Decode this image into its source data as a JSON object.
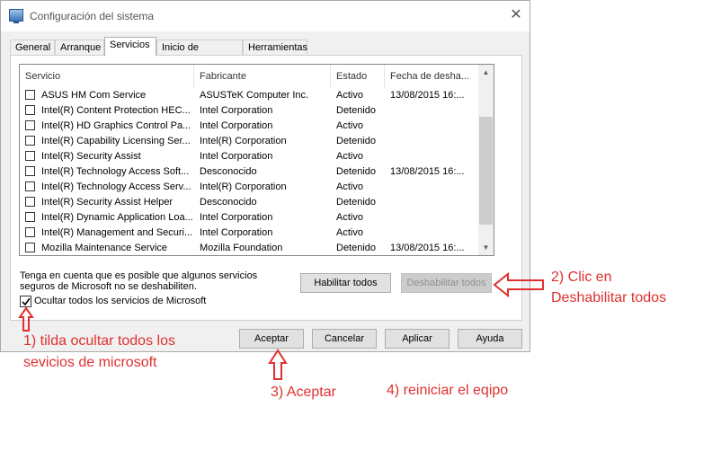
{
  "window": {
    "title": "Configuración del sistema",
    "close_glyph": "✕"
  },
  "tabs": [
    {
      "label": "General"
    },
    {
      "label": "Arranque"
    },
    {
      "label": "Servicios",
      "active": true
    },
    {
      "label": "Inicio de Windows"
    },
    {
      "label": "Herramientas"
    }
  ],
  "table": {
    "headers": [
      "Servicio",
      "Fabricante",
      "Estado",
      "Fecha de desha..."
    ],
    "rows": [
      {
        "servicio": "ASUS HM Com Service",
        "fabricante": "ASUSTeK Computer Inc.",
        "estado": "Activo",
        "fecha": "13/08/2015 16:..."
      },
      {
        "servicio": "Intel(R) Content Protection HEC...",
        "fabricante": "Intel Corporation",
        "estado": "Detenido",
        "fecha": ""
      },
      {
        "servicio": "Intel(R) HD Graphics Control Pa...",
        "fabricante": "Intel Corporation",
        "estado": "Activo",
        "fecha": ""
      },
      {
        "servicio": "Intel(R) Capability Licensing Ser...",
        "fabricante": "Intel(R) Corporation",
        "estado": "Detenido",
        "fecha": ""
      },
      {
        "servicio": "Intel(R) Security Assist",
        "fabricante": "Intel Corporation",
        "estado": "Activo",
        "fecha": ""
      },
      {
        "servicio": "Intel(R) Technology Access Soft...",
        "fabricante": "Desconocido",
        "estado": "Detenido",
        "fecha": "13/08/2015 16:..."
      },
      {
        "servicio": "Intel(R) Technology Access Serv...",
        "fabricante": "Intel(R) Corporation",
        "estado": "Activo",
        "fecha": ""
      },
      {
        "servicio": "Intel(R) Security Assist Helper",
        "fabricante": "Desconocido",
        "estado": "Detenido",
        "fecha": ""
      },
      {
        "servicio": "Intel(R) Dynamic Application Loa...",
        "fabricante": "Intel Corporation",
        "estado": "Activo",
        "fecha": ""
      },
      {
        "servicio": "Intel(R) Management and Securi...",
        "fabricante": "Intel Corporation",
        "estado": "Activo",
        "fecha": ""
      },
      {
        "servicio": "Mozilla Maintenance Service",
        "fabricante": "Mozilla Foundation",
        "estado": "Detenido",
        "fecha": "13/08/2015 16:..."
      }
    ]
  },
  "note": "Tenga en cuenta que es posible que algunos servicios seguros de Microsoft no se deshabiliten.",
  "buttons": {
    "enable_all": "Habilitar todos",
    "disable_all": "Deshabilitar todos",
    "ok": "Aceptar",
    "cancel": "Cancelar",
    "apply": "Aplicar",
    "help": "Ayuda"
  },
  "hide_ms_checkbox": {
    "label": "Ocultar todos los servicios de Microsoft",
    "checked": true
  },
  "annotations": {
    "step1_line1": "1) tilda ocultar todos los",
    "step1_line2": "sevicios de microsoft",
    "step2_line1": "2) Clic en",
    "step2_line2": "Deshabilitar todos",
    "step3": "3) Aceptar",
    "step4": "4) reiniciar el eqipo",
    "arrow_color": "#e03030"
  }
}
